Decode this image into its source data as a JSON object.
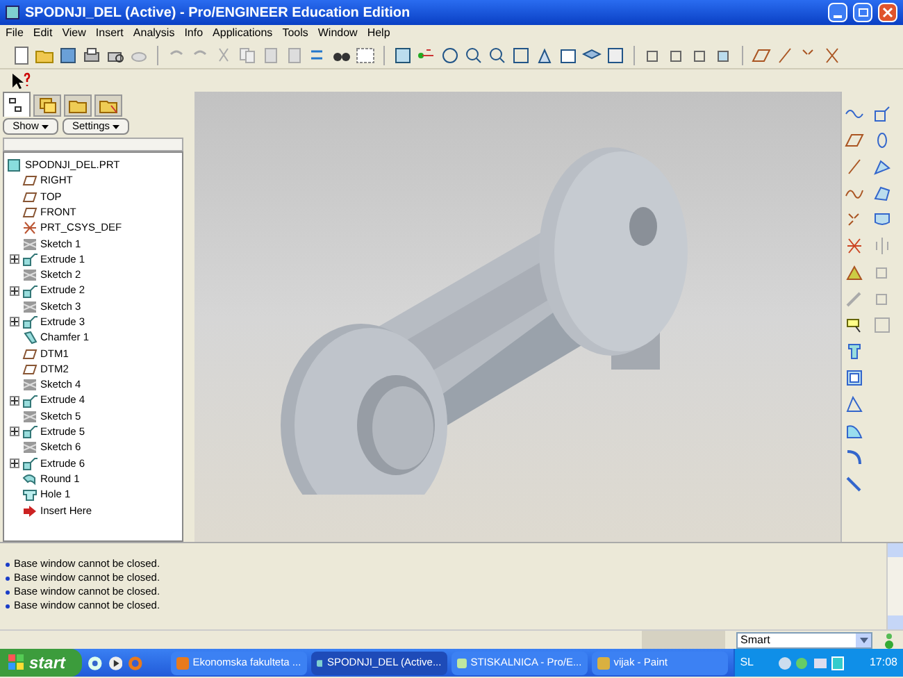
{
  "window": {
    "title": "SPODNJI_DEL (Active) - Pro/ENGINEER Education Edition"
  },
  "menu": [
    "File",
    "Edit",
    "View",
    "Insert",
    "Analysis",
    "Info",
    "Applications",
    "Tools",
    "Window",
    "Help"
  ],
  "navigator": {
    "tabs": [
      {
        "selected": true
      },
      {
        "selected": false
      },
      {
        "selected": false
      },
      {
        "selected": false
      }
    ],
    "buttons": [
      "Show",
      "Settings"
    ],
    "tree": {
      "label": "SPODNJI_DEL.PRT",
      "kind": "part",
      "children": [
        {
          "label": "RIGHT",
          "kind": "plane"
        },
        {
          "label": "TOP",
          "kind": "plane"
        },
        {
          "label": "FRONT",
          "kind": "plane"
        },
        {
          "label": "PRT_CSYS_DEF",
          "kind": "csys"
        },
        {
          "label": "Sketch 1",
          "kind": "sketch"
        },
        {
          "label": "Extrude 1",
          "kind": "extrude",
          "expanded": false
        },
        {
          "label": "Sketch 2",
          "kind": "sketch"
        },
        {
          "label": "Extrude 2",
          "kind": "extrude",
          "expanded": false
        },
        {
          "label": "Sketch 3",
          "kind": "sketch"
        },
        {
          "label": "Extrude 3",
          "kind": "extrude",
          "expanded": false
        },
        {
          "label": "Chamfer 1",
          "kind": "chamfer"
        },
        {
          "label": "DTM1",
          "kind": "plane"
        },
        {
          "label": "DTM2",
          "kind": "plane"
        },
        {
          "label": "Sketch 4",
          "kind": "sketch"
        },
        {
          "label": "Extrude 4",
          "kind": "extrude",
          "expanded": false
        },
        {
          "label": "Sketch 5",
          "kind": "sketch"
        },
        {
          "label": "Extrude 5",
          "kind": "extrude",
          "expanded": false
        },
        {
          "label": "Sketch 6",
          "kind": "sketch"
        },
        {
          "label": "Extrude 6",
          "kind": "extrude",
          "expanded": false
        },
        {
          "label": "Round 1",
          "kind": "round"
        },
        {
          "label": "Hole 1",
          "kind": "hole"
        },
        {
          "label": "Insert Here",
          "kind": "insert"
        }
      ]
    }
  },
  "messages": [
    "Base window cannot be closed.",
    "Base window cannot be closed.",
    "Base window cannot be closed.",
    "Base window cannot be closed."
  ],
  "status_bar": {
    "filter": "Smart"
  },
  "taskbar": {
    "start": "start",
    "tasks": [
      {
        "label": "Ekonomska fakulteta ...",
        "selected": false
      },
      {
        "label": "SPODNJI_DEL (Active...",
        "selected": true
      },
      {
        "label": "STISKALNICA - Pro/E...",
        "selected": false
      },
      {
        "label": "vijak - Paint",
        "selected": false
      }
    ],
    "language": "SL",
    "clock": "17:08"
  }
}
